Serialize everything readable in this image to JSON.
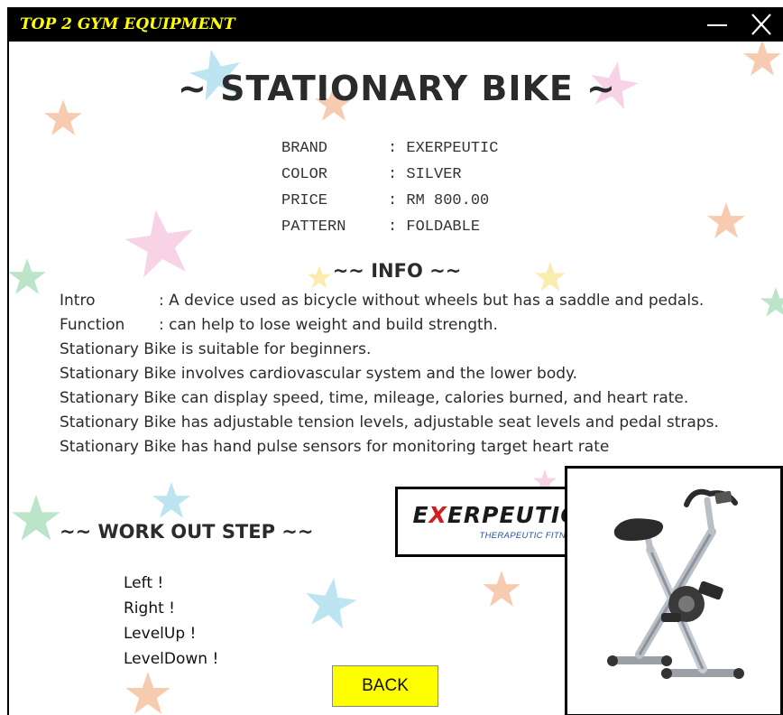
{
  "window": {
    "title": "TOP 2 GYM EQUIPMENT"
  },
  "header": {
    "title": "~ STATIONARY BIKE ~"
  },
  "specs": [
    {
      "label": "BRAND",
      "value": ": EXERPEUTIC"
    },
    {
      "label": "COLOR",
      "value": ": SILVER"
    },
    {
      "label": "PRICE",
      "value": ": RM 800.00"
    },
    {
      "label": "PATTERN",
      "value": ": FOLDABLE"
    }
  ],
  "info": {
    "heading": "~~ INFO ~~",
    "intro_label": "Intro",
    "intro_text": ": A device used as bicycle without wheels but has a saddle and pedals.",
    "function_label": "Function",
    "function_text": ": can help to lose weight and build strength.",
    "lines": [
      "Stationary Bike is suitable for beginners.",
      "Stationary Bike involves cardiovascular system and the lower body.",
      "Stationary Bike can display speed, time, mileage, calories burned, and heart rate.",
      "Stationary Bike has adjustable tension levels, adjustable seat levels and pedal straps.",
      "Stationary Bike has hand pulse sensors for monitoring target heart rate"
    ]
  },
  "workout": {
    "heading": "~~ WORK OUT STEP ~~",
    "steps": [
      "Left !",
      "Right !",
      "LevelUp !",
      "LevelDown !"
    ]
  },
  "buttons": {
    "back": "BACK"
  },
  "logo": {
    "brand_prefix": "E",
    "brand_red": "X",
    "brand_rest": "ERPEUTIC",
    "tagline": "THERAPEUTIC FITNESS"
  },
  "icons": {
    "minimize": "minimize-icon",
    "close": "close-icon"
  },
  "colors": {
    "titlebar": "#000000",
    "title_text": "#ffff00",
    "back_button": "#ffff00"
  }
}
